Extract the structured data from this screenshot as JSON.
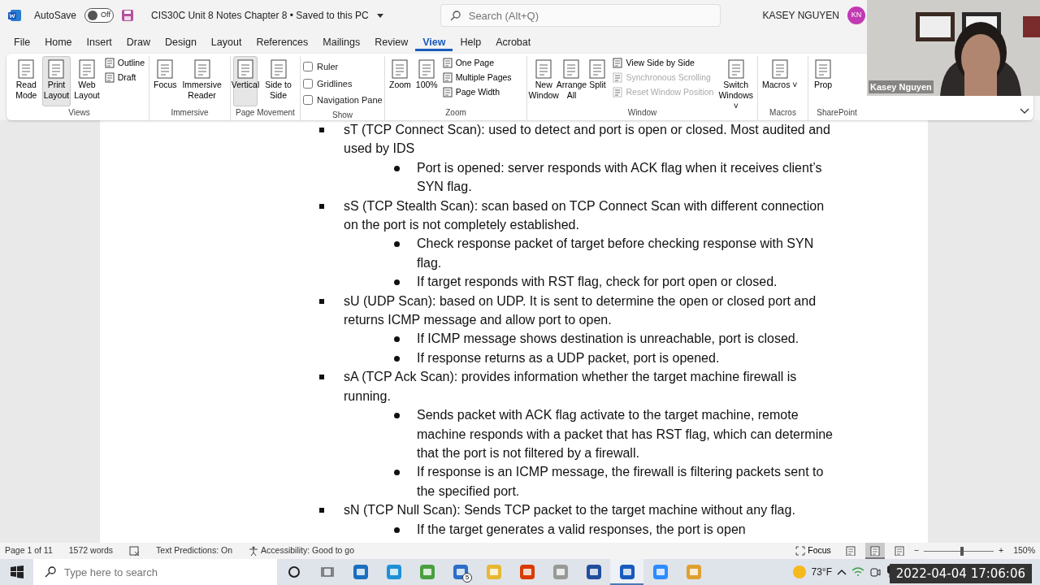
{
  "title_bar": {
    "autosave_label": "AutoSave",
    "autosave": {
      "on": false,
      "label": "Off"
    },
    "title": "CIS30C Unit 8 Notes Chapter 8 • Saved to this PC",
    "search": {
      "placeholder": "Search (Alt+Q)"
    },
    "user": "KASEY NGUYEN",
    "avatar": "KN"
  },
  "tabs": [
    {
      "label": "File",
      "selected": false
    },
    {
      "label": "Home",
      "selected": false
    },
    {
      "label": "Insert",
      "selected": false
    },
    {
      "label": "Draw",
      "selected": false
    },
    {
      "label": "Design",
      "selected": false
    },
    {
      "label": "Layout",
      "selected": false
    },
    {
      "label": "References",
      "selected": false
    },
    {
      "label": "Mailings",
      "selected": false
    },
    {
      "label": "Review",
      "selected": false
    },
    {
      "label": "View",
      "selected": true
    },
    {
      "label": "Help",
      "selected": false
    },
    {
      "label": "Acrobat",
      "selected": false
    }
  ],
  "ribbon": [
    {
      "label": "Views",
      "items": [
        {
          "kind": "large",
          "label": "Read Mode",
          "selected": false
        },
        {
          "kind": "large",
          "label": "Print Layout",
          "selected": true
        },
        {
          "kind": "large",
          "label": "Web Layout",
          "selected": false
        },
        {
          "kind": "stack",
          "items": [
            {
              "label": "Outline"
            },
            {
              "label": "Draft"
            }
          ]
        }
      ]
    },
    {
      "label": "Immersive",
      "items": [
        {
          "kind": "large",
          "label": "Focus",
          "selected": false
        },
        {
          "kind": "large",
          "label": "Immersive Reader",
          "selected": false
        }
      ]
    },
    {
      "label": "Page Movement",
      "items": [
        {
          "kind": "large",
          "label": "Vertical",
          "selected": true
        },
        {
          "kind": "large",
          "label": "Side to Side",
          "selected": false
        }
      ]
    },
    {
      "label": "Show",
      "items": [
        {
          "kind": "checks",
          "items": [
            {
              "label": "Ruler",
              "checked": false
            },
            {
              "label": "Gridlines",
              "checked": false
            },
            {
              "label": "Navigation Pane",
              "checked": false
            }
          ]
        }
      ]
    },
    {
      "label": "Zoom",
      "items": [
        {
          "kind": "large",
          "label": "Zoom",
          "selected": false
        },
        {
          "kind": "large",
          "label": "100%",
          "selected": false
        },
        {
          "kind": "stack",
          "items": [
            {
              "label": "One Page"
            },
            {
              "label": "Multiple Pages"
            },
            {
              "label": "Page Width"
            }
          ]
        }
      ]
    },
    {
      "label": "Window",
      "items": [
        {
          "kind": "large",
          "label": "New Window",
          "selected": false
        },
        {
          "kind": "large",
          "label": "Arrange All",
          "selected": false
        },
        {
          "kind": "large",
          "label": "Split",
          "selected": false
        },
        {
          "kind": "stack",
          "items": [
            {
              "label": "View Side by Side",
              "disabled": false
            },
            {
              "label": "Synchronous Scrolling",
              "disabled": true
            },
            {
              "label": "Reset Window Position",
              "disabled": true
            }
          ]
        },
        {
          "kind": "large",
          "label": "Switch Windows ˅",
          "selected": false
        }
      ]
    },
    {
      "label": "Macros",
      "items": [
        {
          "kind": "large",
          "label": "Macros ˅",
          "selected": false
        }
      ]
    },
    {
      "label": "SharePoint",
      "items": [
        {
          "kind": "large",
          "label": "Prop",
          "selected": false
        }
      ]
    }
  ],
  "document": [
    {
      "text": "sT (TCP Connect Scan): used to detect and port is open or closed. Most audited and used by IDS",
      "children": [
        {
          "text": "Port is opened: server responds with ACK flag when it receives client’s SYN flag."
        }
      ]
    },
    {
      "text": "sS (TCP Stealth Scan): scan based on TCP Connect Scan with different connection on the port is not completely established.",
      "children": [
        {
          "text": "Check response packet of target before checking response with SYN flag."
        },
        {
          "text": "If target responds with RST flag, check for port open or closed."
        }
      ]
    },
    {
      "text": "sU (UDP Scan): based on UDP. It is sent to determine the open or closed port and returns ICMP message and allow port to open.",
      "children": [
        {
          "text": "If ICMP message shows destination is unreachable, port is closed."
        },
        {
          "text": "If response returns as a UDP packet, port is opened."
        }
      ]
    },
    {
      "text": "sA (TCP Ack Scan): provides information whether the target machine firewall is running.",
      "children": [
        {
          "text": "Sends packet with ACK flag activate to the target machine, remote machine responds with a packet that has RST flag, which can determine that the port is not filtered by a firewall."
        },
        {
          "text": "If response is an ICMP message, the firewall is filtering packets sent to the specified port."
        }
      ]
    },
    {
      "text": "sN (TCP Null Scan): Sends TCP packet to the target machine without any flag.",
      "children": [
        {
          "text": "If the target generates a valid responses, the port is open"
        }
      ]
    }
  ],
  "status_bar": {
    "page": "Page 1 of 11",
    "words": "1572 words",
    "predictions": "Text Predictions: On",
    "accessibility": "Accessibility: Good to go",
    "focus": "Focus",
    "views": [
      {
        "selected": false
      },
      {
        "selected": true
      },
      {
        "selected": false
      }
    ],
    "zoom": {
      "out": "−",
      "level": 0.55,
      "in": "+",
      "reading": "150%"
    }
  },
  "webcam": {
    "name": "Kasey Nguyen"
  },
  "taskbar": {
    "search": {
      "placeholder": "Type here to search"
    },
    "apps": [
      {
        "active": false
      },
      {
        "active": false
      },
      {
        "active": false
      },
      {
        "active": false,
        "badge": "5"
      },
      {
        "active": false
      },
      {
        "active": false
      },
      {
        "active": false
      },
      {
        "active": false
      },
      {
        "active": true
      },
      {
        "active": false
      },
      {
        "active": false
      }
    ],
    "weather": "73°F",
    "timestamp": "2022-04-04 17:06:06"
  }
}
